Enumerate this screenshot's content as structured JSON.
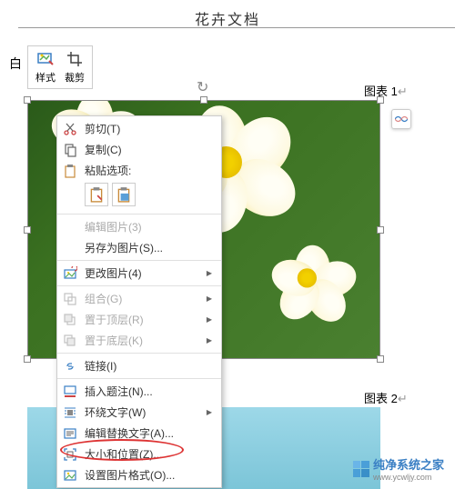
{
  "header": {
    "title": "花卉文档"
  },
  "toolbar": {
    "box_label": "白",
    "style_label": "样式",
    "crop_label": "裁剪"
  },
  "caption1": {
    "text": "图表 1",
    "suffix": "↵"
  },
  "caption2": {
    "text": "图表 2",
    "suffix": "↵"
  },
  "watermark": {
    "text": "纯净系统之家",
    "url": "www.ycwljy.com"
  },
  "menu": {
    "cut": "剪切(T)",
    "copy": "复制(C)",
    "paste_options": "粘贴选项:",
    "edit_picture": "编辑图片(3)",
    "save_as_picture": "另存为图片(S)...",
    "change_picture": "更改图片(4)",
    "group": "组合(G)",
    "bring_to_front": "置于顶层(R)",
    "send_to_back": "置于底层(K)",
    "link": "链接(I)",
    "insert_caption": "插入题注(N)...",
    "wrap_text": "环绕文字(W)",
    "edit_alt_text": "编辑替换文字(A)...",
    "size_position": "大小和位置(Z)...",
    "format_picture": "设置图片格式(O)..."
  }
}
